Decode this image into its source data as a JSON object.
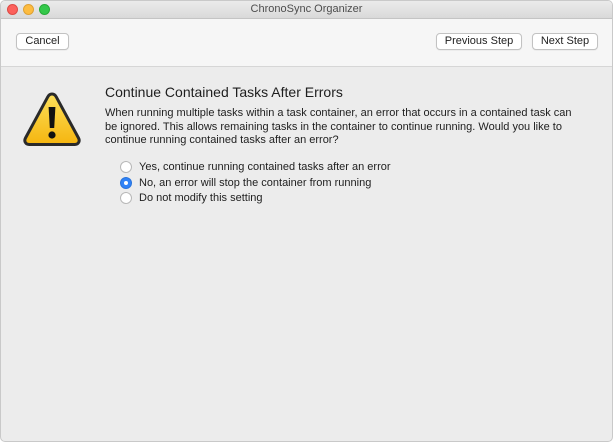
{
  "window": {
    "title": "ChronoSync Organizer"
  },
  "toolbar": {
    "cancel_label": "Cancel",
    "previous_label": "Previous Step",
    "next_label": "Next Step"
  },
  "content": {
    "icon": "warning-triangle-icon",
    "heading": "Continue Contained Tasks After Errors",
    "description": "When running multiple tasks within a task container, an error that occurs in a contained task can be ignored. This allows remaining tasks in the container to continue running. Would you like to continue running contained tasks after an error?",
    "options": [
      {
        "label": "Yes, continue running contained tasks after an error",
        "selected": false
      },
      {
        "label": "No, an error will stop the container from running",
        "selected": true
      },
      {
        "label": "Do not modify this setting",
        "selected": false
      }
    ]
  },
  "colors": {
    "accent": "#2f82f7",
    "warning_fill": "#f8c51c",
    "close": "#fc605b",
    "minimize": "#fdbc40",
    "zoom": "#34c84a"
  }
}
